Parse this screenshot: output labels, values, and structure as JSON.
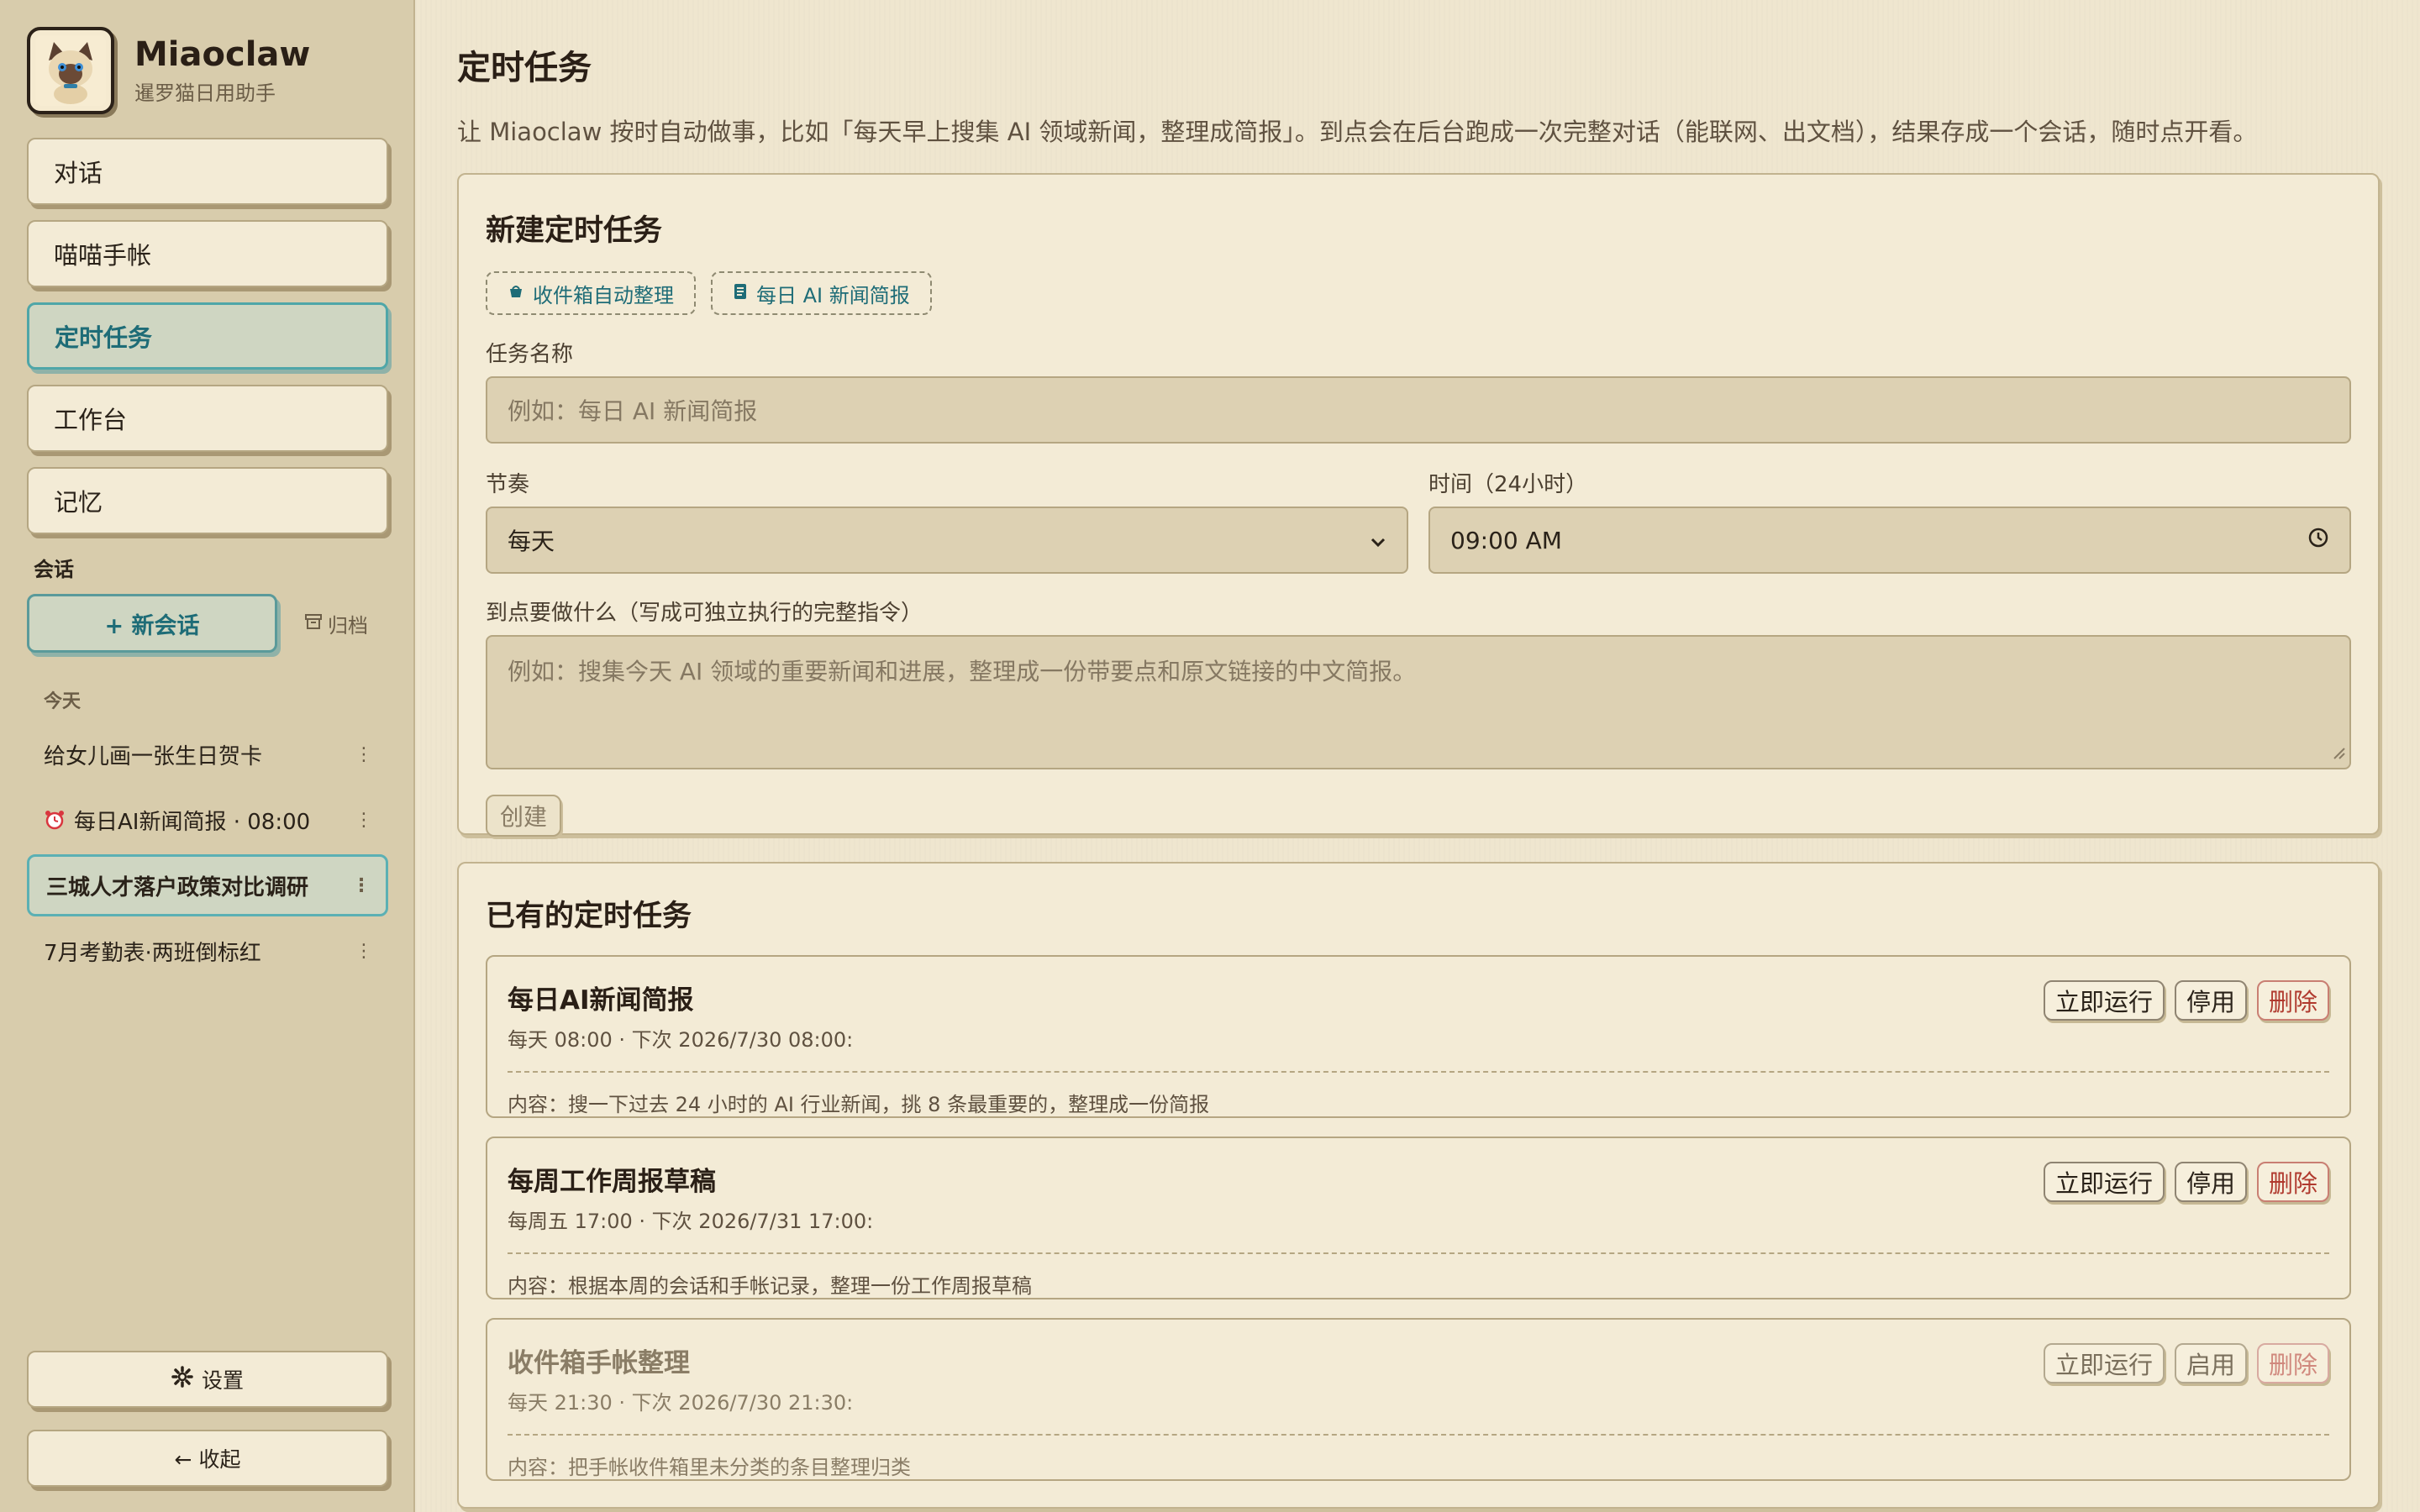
{
  "app": {
    "name": "Miaoclaw",
    "subtitle": "暹罗猫日用助手"
  },
  "nav": [
    {
      "label": "对话",
      "active": false
    },
    {
      "label": "喵喵手帐",
      "active": false
    },
    {
      "label": "定时任务",
      "active": true
    },
    {
      "label": "工作台",
      "active": false
    },
    {
      "label": "记忆",
      "active": false
    }
  ],
  "conversations": {
    "section_label": "会话",
    "new_label": "+ 新会话",
    "archive_label": "归档",
    "group_label": "今天",
    "items": [
      {
        "title": "给女儿画一张生日贺卡"
      },
      {
        "title": "每日AI新闻简报 · 08:00"
      },
      {
        "title": "三城人才落户政策对比调研"
      },
      {
        "title": "7月考勤表·两班倒标红"
      }
    ]
  },
  "sidebar_bottom": {
    "settings_label": "设置",
    "collapse_label": "← 收起"
  },
  "page": {
    "title": "定时任务",
    "description": "让 Miaoclaw 按时自动做事，比如「每天早上搜集 AI 领域新闻，整理成简报」。到点会在后台跑成一次完整对话（能联网、出文档），结果存成一个会话，随时点开看。"
  },
  "new_task": {
    "title": "新建定时任务",
    "templates": [
      "收件箱自动整理",
      "每日 AI 新闻简报"
    ],
    "name_label": "任务名称",
    "name_placeholder": "例如：每日 AI 新闻简报",
    "cadence_label": "节奏",
    "cadence_value": "每天",
    "time_label": "时间（24小时）",
    "time_value": "09:00  AM",
    "prompt_label": "到点要做什么（写成可独立执行的完整指令）",
    "prompt_placeholder": "例如：搜集今天 AI 领域的重要新闻和进展，整理成一份带要点和原文链接的中文简报。",
    "create_label": "创建"
  },
  "existing": {
    "title": "已有的定时任务",
    "run_label": "立即运行",
    "delete_label": "删除",
    "tasks": [
      {
        "name": "每日AI新闻简报",
        "meta": "每天 08:00 · 下次 2026/7/30 08:00:",
        "content": "内容：搜一下过去 24 小时的 AI 行业新闻，挑 8 条最重要的，整理成一份简报",
        "toggle_label": "停用",
        "enabled": true
      },
      {
        "name": "每周工作周报草稿",
        "meta": "每周五 17:00 · 下次 2026/7/31 17:00:",
        "content": "内容：根据本周的会话和手帐记录，整理一份工作周报草稿",
        "toggle_label": "停用",
        "enabled": true
      },
      {
        "name": "收件箱手帐整理",
        "meta": "每天 21:30 · 下次 2026/7/30 21:30:",
        "content": "内容：把手帐收件箱里未分类的条目整理归类",
        "toggle_label": "启用",
        "enabled": false
      }
    ]
  },
  "colors": {
    "accent": "#1e6c77",
    "sidebar_bg": "#d8ccac",
    "main_bg": "#efe6cf",
    "danger": "#b03a2e"
  },
  "icons": {
    "logo": "siamese-cat-logo-icon",
    "archive": "archive-box-icon",
    "alarm": "alarm-clock-icon",
    "settings": "gear-icon",
    "template_inbox": "basket-icon",
    "template_news": "document-icon",
    "time": "clock-icon",
    "select": "chevron-down-icon"
  }
}
